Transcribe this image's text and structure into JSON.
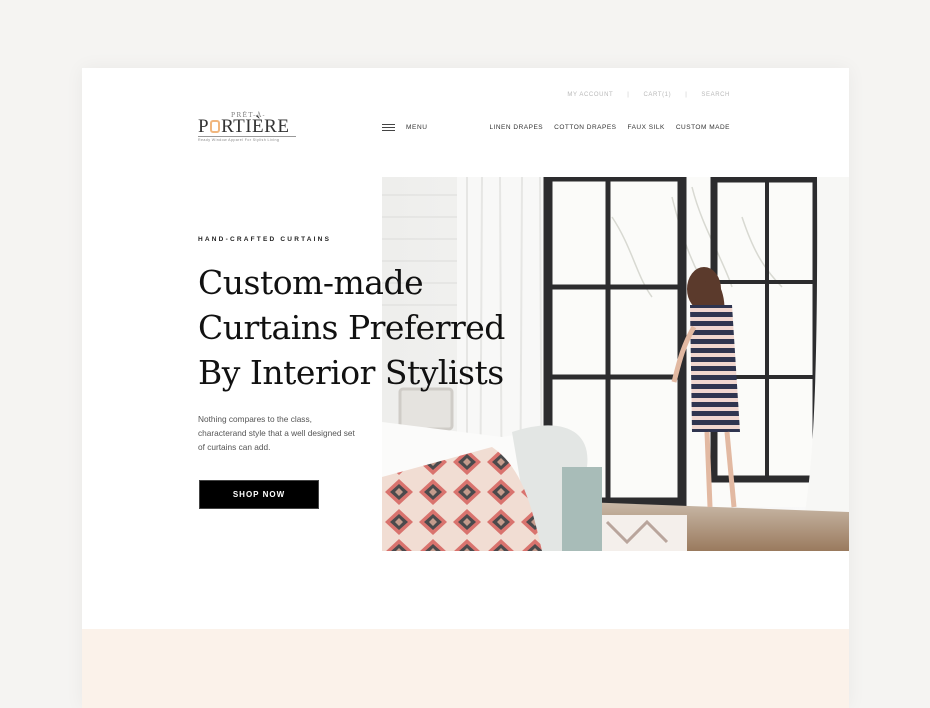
{
  "brand": {
    "prefix": "PRÊT-À-",
    "name_start": "P",
    "name_end": "RTIÈRE",
    "tagline": "Ready Window Apparel For Stylish Living",
    "accent_color": "#f1b77f"
  },
  "utility_nav": {
    "items": [
      {
        "label": "MY ACCOUNT"
      },
      {
        "label": "CART(1)"
      },
      {
        "label": "SEARCH"
      }
    ],
    "separator": "|"
  },
  "menu": {
    "icon": "hamburger-icon",
    "label": "MENU"
  },
  "main_nav": {
    "items": [
      {
        "label": "LINEN DRAPES"
      },
      {
        "label": "COTTON DRAPES"
      },
      {
        "label": "FAUX SILK"
      },
      {
        "label": "CUSTOM MADE"
      }
    ]
  },
  "hero": {
    "eyebrow": "HAND-CRAFTED CURTAINS",
    "headline_lines": [
      "Custom-made",
      "Curtains Preferred",
      "By Interior Stylists"
    ],
    "body": "Nothing compares to the class, characterand style that a well designed set of curtains can add.",
    "cta_label": "SHOP NOW",
    "image_alt": "Woman in striped dress opening black-framed French doors beside a bed with a patterned throw and white curtains"
  },
  "colors": {
    "page_background": "#f5f4f2",
    "band": "#fbf2ea",
    "cta_background": "#000000"
  }
}
